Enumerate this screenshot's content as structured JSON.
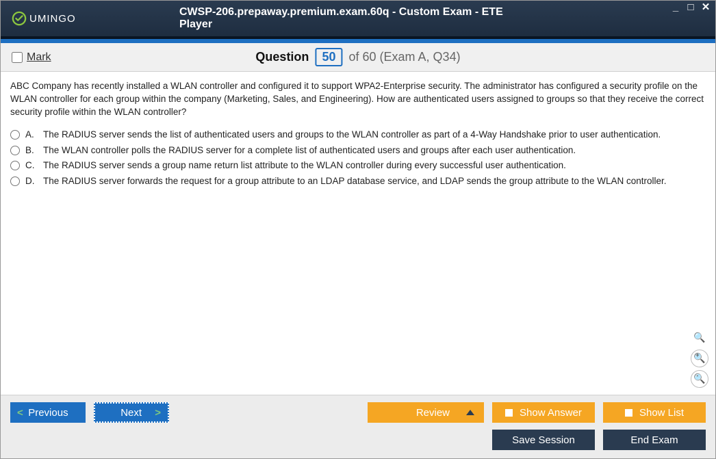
{
  "window": {
    "logo_text": "UMINGO",
    "title": "CWSP-206.prepaway.premium.exam.60q - Custom Exam - ETE Player"
  },
  "header": {
    "mark_label": "Mark",
    "question_word": "Question",
    "question_num": "50",
    "of_text": "of 60 (Exam A, Q34)"
  },
  "question": {
    "text": "ABC Company has recently installed a WLAN controller and configured it to support WPA2-Enterprise security. The administrator has configured a security profile on the WLAN controller for each group within the company (Marketing, Sales, and Engineering). How are authenticated users assigned to groups so that they receive the correct security profile within the WLAN controller?",
    "options": [
      {
        "letter": "A.",
        "text": "The RADIUS server sends the list of authenticated users and groups to the WLAN controller as part of a 4-Way Handshake prior to user authentication."
      },
      {
        "letter": "B.",
        "text": "The WLAN controller polls the RADIUS server for a complete list of authenticated users and groups after each user authentication."
      },
      {
        "letter": "C.",
        "text": "The RADIUS server sends a group name return list attribute to the WLAN controller during every successful user authentication."
      },
      {
        "letter": "D.",
        "text": "The RADIUS server forwards the request for a group attribute to an LDAP database service, and LDAP sends the group attribute to the WLAN controller."
      }
    ]
  },
  "footer": {
    "previous": "Previous",
    "next": "Next",
    "review": "Review",
    "show_answer": "Show Answer",
    "show_list": "Show List",
    "save_session": "Save Session",
    "end_exam": "End Exam"
  }
}
